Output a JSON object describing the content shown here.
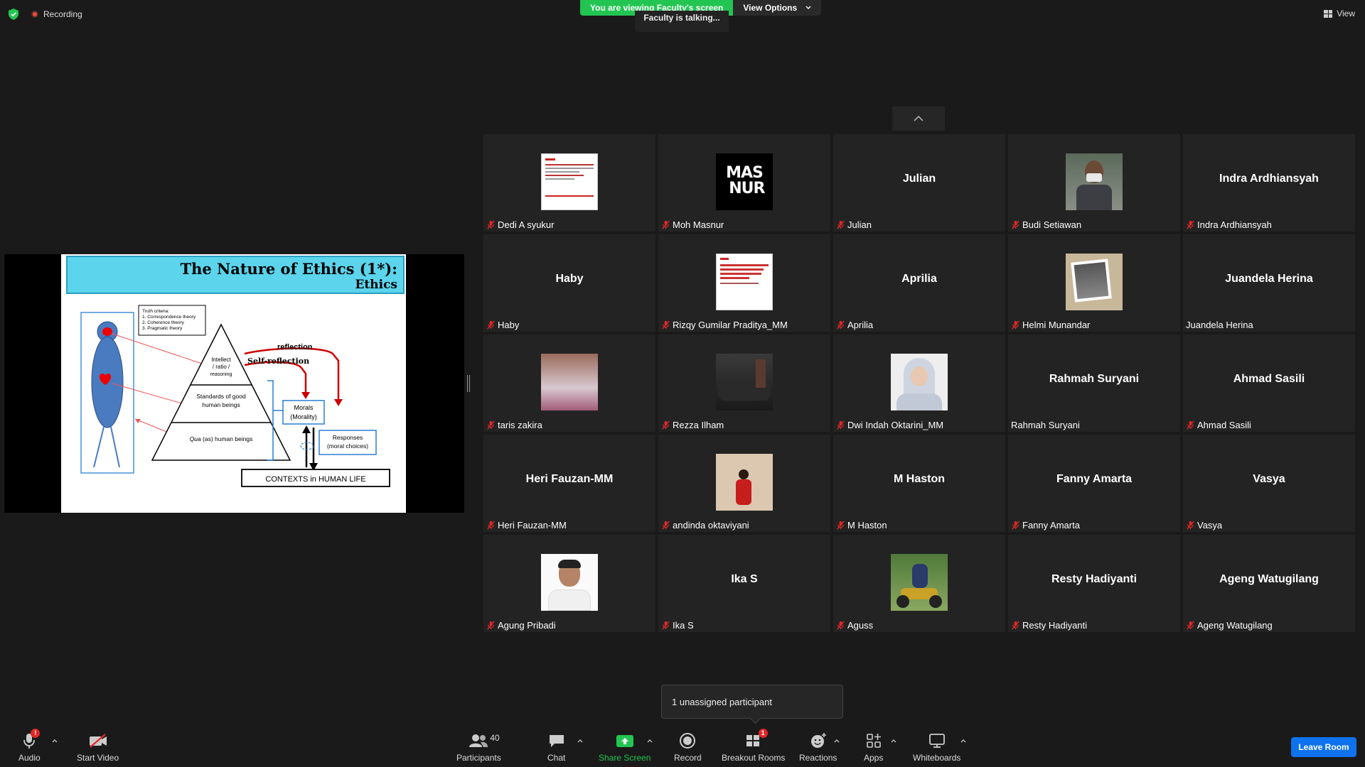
{
  "top": {
    "recording_label": "Recording",
    "viewing_text": "You are viewing Faculty's screen",
    "view_options_label": "View Options",
    "talking_text": "Faculty is talking...",
    "view_label": "View"
  },
  "slide": {
    "title_line1": "The Nature of Ethics (1*):",
    "title_line2": "Ethics",
    "truth_criteria_title": "Truth criteria:",
    "truth_criteria_1": "1. Correspondence theory",
    "truth_criteria_2": "2. Coherence theory",
    "truth_criteria_3": "3. Pragmatic theory",
    "intellect_1": "Intellect",
    "intellect_2": "/ ratio /",
    "intellect_3": "reasoning",
    "standards_1": "Standards of good",
    "standards_2": "human beings",
    "qua_italic": "Qua",
    "qua_rest": "(as) human beings",
    "reflection": "reflection",
    "self_reflection": "Self-reflection",
    "morals_1": "Morals",
    "morals_2": "(Morality)",
    "responses_1": "Responses",
    "responses_2": "(moral choices)",
    "contexts": "CONTEXTS in HUMAN LIFE"
  },
  "participants": [
    {
      "display": "",
      "name": "Dedi A syukur",
      "muted": true,
      "pic": "doc"
    },
    {
      "display": "",
      "name": "Moh Masnur",
      "muted": true,
      "pic": "masnur"
    },
    {
      "display": "Julian",
      "name": "Julian",
      "muted": true,
      "pic": ""
    },
    {
      "display": "",
      "name": "Budi Setiawan",
      "muted": true,
      "pic": "photo-mask"
    },
    {
      "display": "Indra Ardhiansyah",
      "name": "Indra Ardhiansyah",
      "muted": true,
      "pic": ""
    },
    {
      "display": "Haby",
      "name": "Haby",
      "muted": true,
      "pic": ""
    },
    {
      "display": "",
      "name": "Rizqy Gumilar Praditya_MM",
      "muted": true,
      "pic": "doc2"
    },
    {
      "display": "Aprilia",
      "name": "Aprilia",
      "muted": true,
      "pic": ""
    },
    {
      "display": "",
      "name": "Helmi Munandar",
      "muted": true,
      "pic": "photo-frame"
    },
    {
      "display": "Juandela Herina",
      "name": "Juandela Herina",
      "muted": false,
      "pic": ""
    },
    {
      "display": "",
      "name": "taris zakira",
      "muted": true,
      "pic": "photo-group"
    },
    {
      "display": "",
      "name": "Rezza Ilham",
      "muted": true,
      "pic": "photo-car"
    },
    {
      "display": "",
      "name": "Dwi Indah Oktarini_MM",
      "muted": true,
      "pic": "photo-hijab"
    },
    {
      "display": "Rahmah Suryani",
      "name": "Rahmah Suryani",
      "muted": false,
      "pic": ""
    },
    {
      "display": "Ahmad Sasili",
      "name": "Ahmad Sasili",
      "muted": true,
      "pic": ""
    },
    {
      "display": "Heri Fauzan-MM",
      "name": "Heri Fauzan-MM",
      "muted": true,
      "pic": ""
    },
    {
      "display": "",
      "name": "andinda oktaviyani",
      "muted": true,
      "pic": "photo-red"
    },
    {
      "display": "M Haston",
      "name": "M Haston",
      "muted": true,
      "pic": ""
    },
    {
      "display": "Fanny Amarta",
      "name": "Fanny Amarta",
      "muted": true,
      "pic": ""
    },
    {
      "display": "Vasya",
      "name": "Vasya",
      "muted": true,
      "pic": ""
    },
    {
      "display": "",
      "name": "Agung Pribadi",
      "muted": true,
      "pic": "photo-man"
    },
    {
      "display": "Ika S",
      "name": "Ika S",
      "muted": true,
      "pic": ""
    },
    {
      "display": "",
      "name": "Aguss",
      "muted": true,
      "pic": "photo-bike"
    },
    {
      "display": "Resty Hadiyanti",
      "name": "Resty Hadiyanti",
      "muted": true,
      "pic": ""
    },
    {
      "display": "Ageng Watugilang",
      "name": "Ageng Watugilang",
      "muted": true,
      "pic": ""
    }
  ],
  "tooltip": {
    "text": "1 unassigned participant"
  },
  "toolbar": {
    "audio": "Audio",
    "audio_badge": "!",
    "start_video": "Start Video",
    "participants": "Participants",
    "participants_count": "40",
    "chat": "Chat",
    "share_screen": "Share Screen",
    "record": "Record",
    "breakout_rooms": "Breakout Rooms",
    "breakout_badge": "1",
    "reactions": "Reactions",
    "apps": "Apps",
    "whiteboards": "Whiteboards",
    "leave_room": "Leave Room"
  },
  "colors": {
    "accent_green": "#23c552",
    "leave_blue": "#0e72ed",
    "mute_red": "#e02828",
    "tile_bg": "#232323"
  }
}
